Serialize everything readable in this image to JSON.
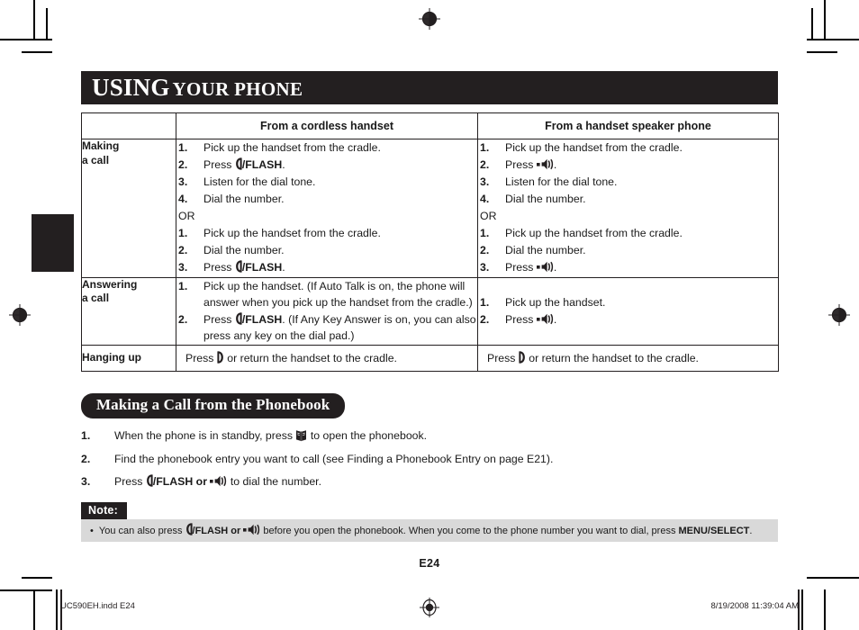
{
  "banner": {
    "word_big": "USING",
    "word_small": "YOUR PHONE"
  },
  "table": {
    "headers": [
      "",
      "From a cordless handset",
      "From a handset speaker phone"
    ],
    "rows": [
      {
        "label": "Making\na call",
        "cordless": {
          "steps_a": [
            {
              "num": "1.",
              "pre": "Pick up the handset from the cradle.",
              "icon": "",
              "post": ""
            },
            {
              "num": "2.",
              "pre": "Press ",
              "icon": "handset-talk-icon",
              "post": "/FLASH."
            },
            {
              "num": "3.",
              "pre": "Listen for the dial tone.",
              "icon": "",
              "post": ""
            },
            {
              "num": "4.",
              "pre": "Dial the number.",
              "icon": "",
              "post": ""
            }
          ],
          "or": "OR",
          "steps_b": [
            {
              "num": "1.",
              "pre": "Pick up the handset from the cradle.",
              "icon": "",
              "post": ""
            },
            {
              "num": "2.",
              "pre": "Dial the number.",
              "icon": "",
              "post": ""
            },
            {
              "num": "3.",
              "pre": "Press ",
              "icon": "handset-talk-icon",
              "post": "/FLASH."
            }
          ]
        },
        "speaker": {
          "steps_a": [
            {
              "num": "1.",
              "pre": "Pick up the handset from the cradle.",
              "icon": "",
              "post": ""
            },
            {
              "num": "2.",
              "pre": "Press ",
              "icon": "speakerphone-icon",
              "post": "."
            },
            {
              "num": "3.",
              "pre": "Listen for the dial tone.",
              "icon": "",
              "post": ""
            },
            {
              "num": "4.",
              "pre": "Dial the number.",
              "icon": "",
              "post": ""
            }
          ],
          "or": "OR",
          "steps_b": [
            {
              "num": "1.",
              "pre": "Pick up the handset from the cradle.",
              "icon": "",
              "post": ""
            },
            {
              "num": "2.",
              "pre": "Dial the number.",
              "icon": "",
              "post": ""
            },
            {
              "num": "3.",
              "pre": "Press ",
              "icon": "speakerphone-icon",
              "post": "."
            }
          ]
        }
      },
      {
        "label": "Answering\na call",
        "cordless": {
          "steps_a": [
            {
              "num": "1.",
              "pre": "Pick up the handset. (If Auto Talk is on, the phone will answer when you pick up the handset from the cradle.)",
              "icon": "",
              "post": ""
            },
            {
              "num": "2.",
              "pre": "Press ",
              "icon": "handset-talk-icon",
              "post": "/FLASH. (If Any Key Answer is on, you can also press any key on the dial pad.)"
            }
          ]
        },
        "speaker": {
          "steps_a": [
            {
              "num": "1.",
              "pre": "Pick up the handset.",
              "icon": "",
              "post": ""
            },
            {
              "num": "2.",
              "pre": "Press ",
              "icon": "speakerphone-icon",
              "post": "."
            }
          ]
        }
      },
      {
        "label": "Hanging up",
        "cordless_text": {
          "pre": "Press ",
          "icon": "handset-off-icon",
          "post": " or return the handset to the cradle."
        },
        "speaker_text": {
          "pre": "Press ",
          "icon": "handset-off-icon",
          "post": " or return the handset to the cradle."
        }
      }
    ]
  },
  "section": {
    "heading": "Making a Call from the Phonebook",
    "steps": [
      {
        "num": "1.",
        "pre": "When the phone is in standby, press ",
        "icon": "phonebook-icon",
        "post": " to open the phonebook."
      },
      {
        "num": "2.",
        "pre": "Find the phonebook entry you want to call (see Finding a Phonebook Entry on page E21).",
        "icon": "",
        "post": ""
      },
      {
        "num": "3.",
        "pre": "Press ",
        "icon": "handset-talk-icon",
        "mid": "/FLASH or ",
        "icon2": "speakerphone-icon",
        "post": " to dial the number."
      }
    ]
  },
  "note": {
    "label": "Note:",
    "bullet": "•",
    "text_1": "You can also press ",
    "icon_1": "handset-talk-icon",
    "text_2": "/FLASH or ",
    "icon_2": "speakerphone-icon",
    "text_3": " before you open the phonebook. When you come to the phone number you want to dial, press ",
    "text_4": "MENU/SELECT",
    "text_5": "."
  },
  "footer": {
    "page_number": "E24",
    "file_name": "UC590EH.indd   E24",
    "timestamp": "8/19/2008   11:39:04 AM"
  },
  "colors": {
    "ink": "#231f20",
    "note_bg": "#d9d9d9",
    "paper": "#ffffff"
  }
}
